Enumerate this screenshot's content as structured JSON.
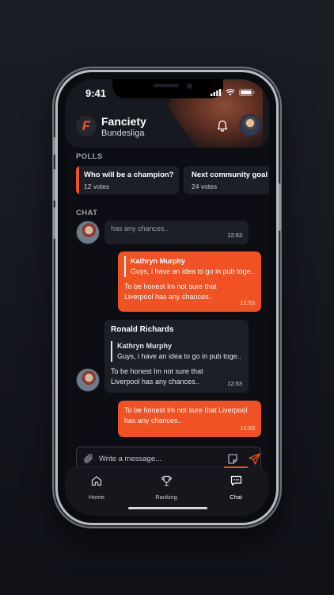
{
  "status": {
    "time": "9:41"
  },
  "header": {
    "app_name": "Fanciety",
    "league": "Bundesliga",
    "logo_letter": "F"
  },
  "polls_label": "POLLS",
  "polls": [
    {
      "question": "Who will be a champion?",
      "votes": "12 votes"
    },
    {
      "question": "Next community goal pu",
      "votes": "24 votes"
    }
  ],
  "chat_label": "CHAT",
  "messages": [
    {
      "text": "has any chances..",
      "time": "12:53"
    },
    {
      "quote_name": "Kathryn Murphy",
      "quote_text": "Guys, i have an idea to go in pub toge..",
      "text": "To be honest Im not sure that Liverpool has any chances..",
      "time": "12:53"
    },
    {
      "sender": "Ronald Richards",
      "quote_name": "Kathryn Murphy",
      "quote_text": "Guys, i have an idea to go in pub toge..",
      "text": "To be honest Im not sure that Liverpool has any chances..",
      "time": "12:53"
    },
    {
      "text": "To be honest Im not sure that Liverpool has any chances..",
      "time": "12:53"
    }
  ],
  "composer": {
    "placeholder": "Write a message..."
  },
  "tabs": [
    {
      "label": "Home"
    },
    {
      "label": "Ranking"
    },
    {
      "label": "Chat"
    }
  ],
  "colors": {
    "accent": "#f05223",
    "background": "#0d0e13",
    "card": "#1d1f27"
  }
}
